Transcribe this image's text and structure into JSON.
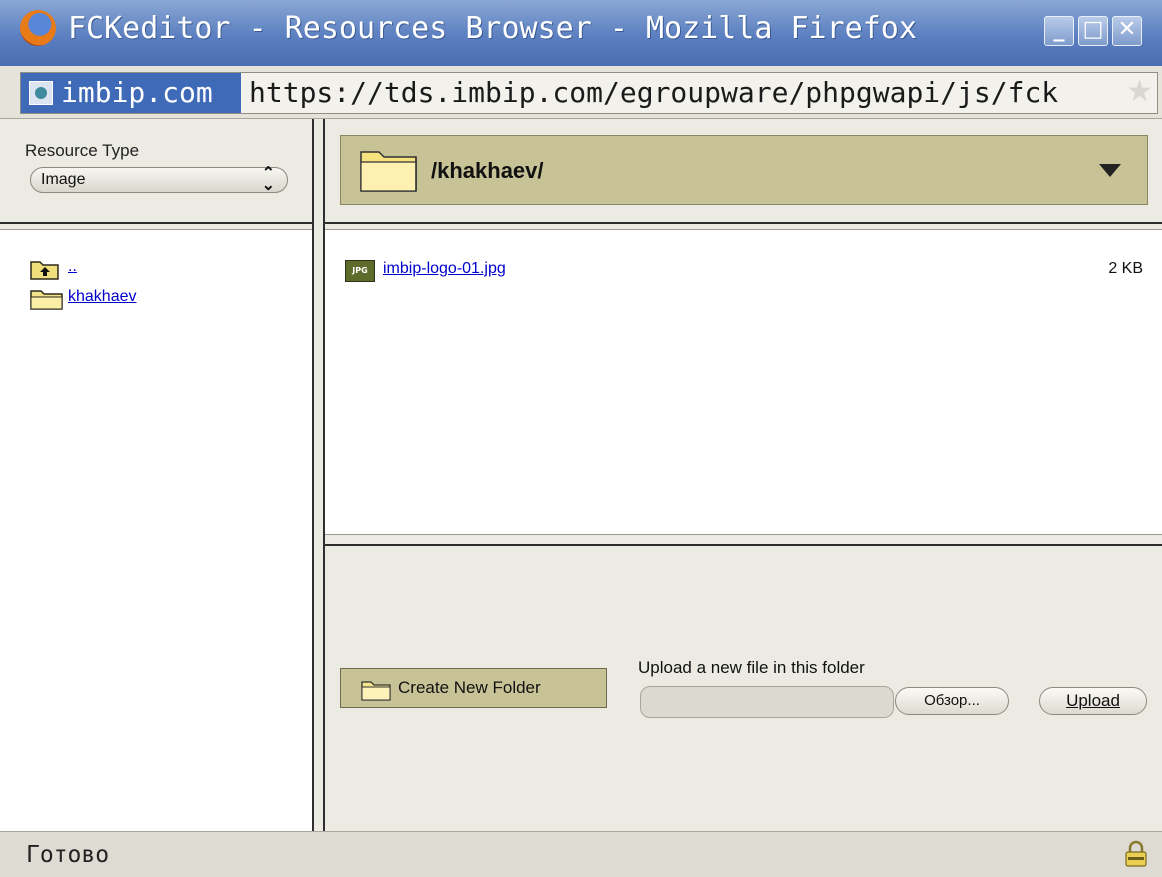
{
  "window": {
    "title": "FCKeditor - Resources Browser - Mozilla Firefox",
    "minimize_glyph": "_",
    "maximize_glyph": "□",
    "close_glyph": "✕"
  },
  "addressbar": {
    "site": "imbip.com",
    "url": "https://tds.imbip.com/egroupware/phpgwapi/js/fck"
  },
  "resource_type": {
    "label": "Resource Type",
    "selected": "Image"
  },
  "folder_tree": [
    {
      "label": "..",
      "icon": "folder-up-icon"
    },
    {
      "label": "khakhaev",
      "icon": "folder-icon"
    }
  ],
  "current_folder": {
    "path": "/khakhaev/"
  },
  "files": [
    {
      "name": "imbip-logo-01.jpg",
      "size": "2 KB",
      "icon_text": "JPG"
    }
  ],
  "actions": {
    "create_folder": "Create New Folder",
    "upload_label": "Upload a new file in this folder",
    "browse": "Обзор...",
    "upload": "Upload"
  },
  "status": {
    "text": "Готово"
  },
  "colors": {
    "titlebar": "#5b7fc0",
    "folder_bar": "#c8c397",
    "link": "#0000cc"
  }
}
